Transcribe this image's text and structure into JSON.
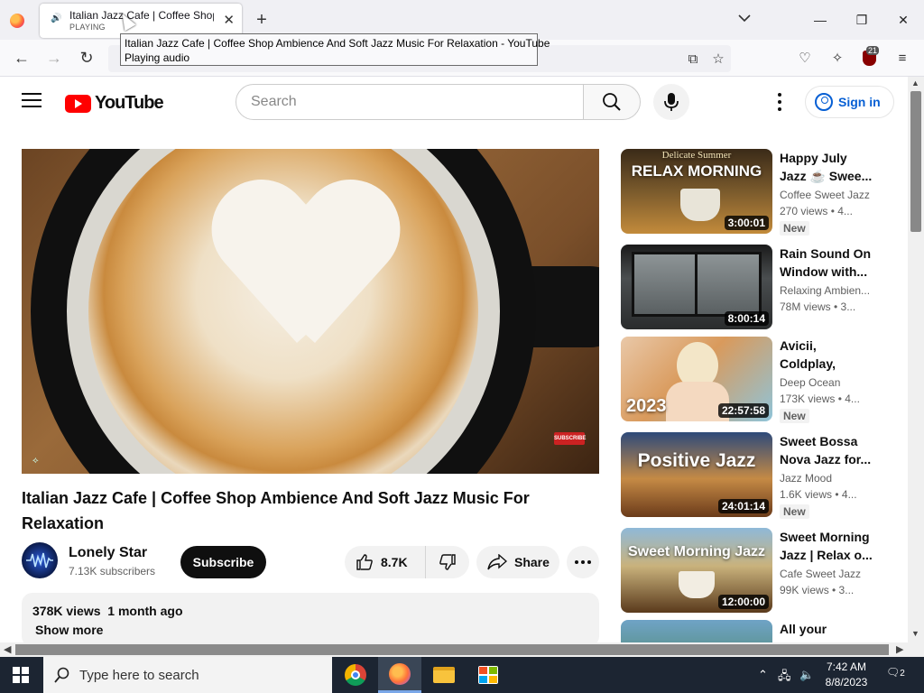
{
  "browser": {
    "tab": {
      "title": "Italian Jazz Cafe | Coffee Shop",
      "status": "PLAYING"
    },
    "tooltip": {
      "line1": "Italian Jazz Cafe | Coffee Shop Ambience And Soft Jazz Music For Relaxation - YouTube",
      "line2": "Playing audio"
    },
    "extension_badge": "21"
  },
  "youtube": {
    "logo_text": "YouTube",
    "search_placeholder": "Search",
    "sign_in": "Sign in"
  },
  "video": {
    "title": "Italian Jazz Cafe | Coffee Shop Ambience And Soft Jazz Music For Relaxation",
    "channel": "Lonely Star",
    "subscribers": "7.13K subscribers",
    "subscribe_label": "Subscribe",
    "likes": "8.7K",
    "share_label": "Share",
    "views": "378K views",
    "age": "1 month ago",
    "show_more": "Show more",
    "watermark_subscribe": "SUBSCRIBE"
  },
  "sidebar": [
    {
      "thumb_top": "Delicate Summer",
      "thumb_main": "RELAX MORNING",
      "duration": "3:00:01",
      "title": "Happy July Jazz ☕ Swee...",
      "channel": "Coffee Sweet Jazz",
      "meta": "270 views  • 4...",
      "badge": "New"
    },
    {
      "thumb_top": "",
      "thumb_main": "",
      "duration": "8:00:14",
      "title": "Rain Sound On Window with...",
      "channel": "Relaxing Ambien...",
      "meta": "78M views  • 3...",
      "badge": ""
    },
    {
      "thumb_top": "",
      "thumb_main": "2023",
      "duration": "22:57:58",
      "title": "Avicii, Coldplay, Martin Garrix ...",
      "channel": "Deep Ocean",
      "meta": "173K views  • 4...",
      "badge": "New"
    },
    {
      "thumb_top": "",
      "thumb_main": "Positive Jazz",
      "duration": "24:01:14",
      "title": "Sweet Bossa Nova Jazz for...",
      "channel": "Jazz Mood",
      "meta": "1.6K views  • 4...",
      "badge": "New"
    },
    {
      "thumb_top": "",
      "thumb_main": "Sweet Morning Jazz",
      "duration": "12:00:00",
      "title": "Sweet Morning Jazz | Relax o...",
      "channel": "Cafe Sweet Jazz",
      "meta": "99K views  • 3...",
      "badge": ""
    },
    {
      "thumb_top": "",
      "thumb_main": "",
      "duration": "",
      "title": "All your worries",
      "channel": "",
      "meta": "",
      "badge": ""
    }
  ],
  "taskbar": {
    "search_placeholder": "Type here to search",
    "time": "7:42 AM",
    "date": "8/8/2023",
    "notifications": "2"
  },
  "colors": {
    "yt_red": "#ff0000",
    "link_blue": "#065fd4",
    "taskbar": "#1c2532"
  }
}
